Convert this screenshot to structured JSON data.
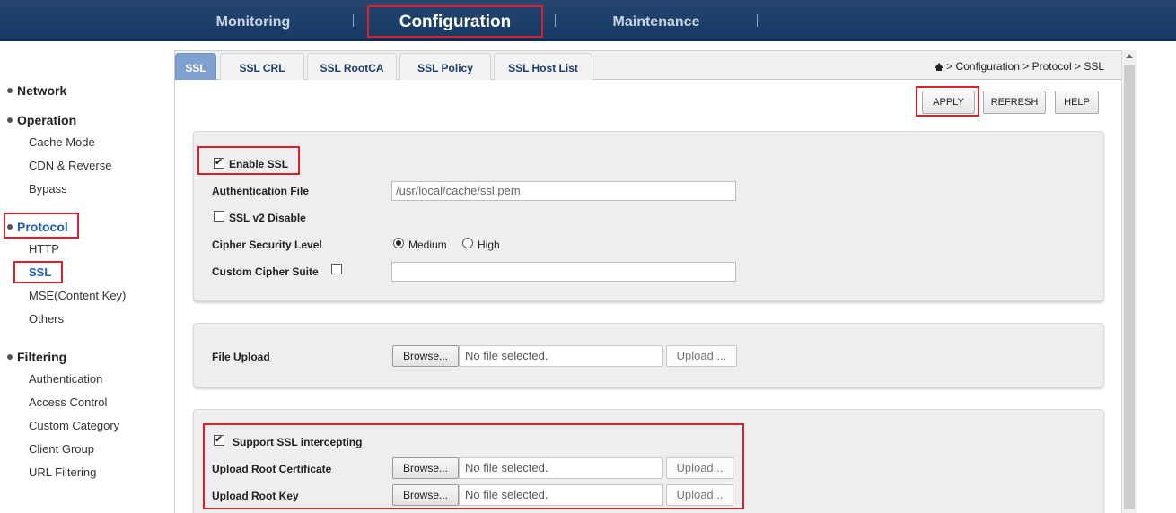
{
  "topnav": {
    "items": [
      {
        "label": "Monitoring"
      },
      {
        "label": "Configuration"
      },
      {
        "label": "Maintenance"
      }
    ]
  },
  "sidebar": {
    "network": "Network",
    "operation": "Operation",
    "operation_items": [
      "Cache Mode",
      "CDN & Reverse",
      "Bypass"
    ],
    "protocol": "Protocol",
    "protocol_items": [
      "HTTP",
      "SSL",
      "MSE(Content Key)",
      "Others"
    ],
    "filtering": "Filtering",
    "filtering_items": [
      "Authentication",
      "Access Control",
      "Custom Category",
      "Client Group",
      "URL Filtering"
    ]
  },
  "tabs": [
    "SSL",
    "SSL CRL",
    "SSL RootCA",
    "SSL Policy",
    "SSL Host List"
  ],
  "breadcrumb": "> Configuration > Protocol > SSL",
  "buttons": {
    "apply": "APPLY",
    "refresh": "REFRESH",
    "help": "HELP"
  },
  "ssl": {
    "enable_label": "Enable SSL",
    "enable_checked": true,
    "auth_file_label": "Authentication File",
    "auth_file_value": "/usr/local/cache/ssl.pem",
    "v2_disable_label": "SSL v2 Disable",
    "v2_disable_checked": false,
    "cipher_level_label": "Cipher Security Level",
    "cipher_options": [
      "Medium",
      "High"
    ],
    "cipher_selected": "Medium",
    "custom_cipher_label": "Custom Cipher Suite",
    "custom_cipher_checked": false,
    "custom_cipher_value": ""
  },
  "file_upload": {
    "label": "File Upload",
    "browse": "Browse...",
    "status": "No file selected.",
    "upload": "Upload ..."
  },
  "intercept": {
    "support_label": "Support SSL intercepting",
    "support_checked": true,
    "root_cert_label": "Upload Root Certificate",
    "root_key_label": "Upload Root Key",
    "browse": "Browse...",
    "status": "No file selected.",
    "upload": "Upload..."
  },
  "colors": {
    "highlight": "#d9202b",
    "nav_bg": "#1d3f6b",
    "active_tab": "#7ea1cf"
  }
}
